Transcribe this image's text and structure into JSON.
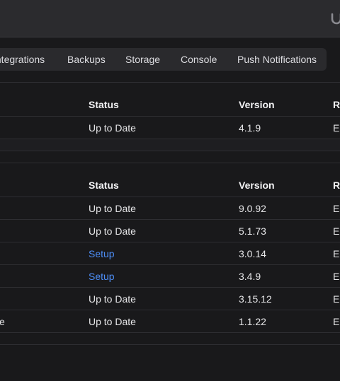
{
  "header": {
    "brand_logo_icon": "ubiquiti-u-icon"
  },
  "tabs": [
    {
      "label": "Integrations"
    },
    {
      "label": "Backups"
    },
    {
      "label": "Storage"
    },
    {
      "label": "Console"
    },
    {
      "label": "Push Notifications"
    }
  ],
  "table1": {
    "headers": {
      "status": "Status",
      "version": "Version",
      "release": "Re"
    },
    "rows": [
      {
        "name": "",
        "status": "Up to Date",
        "version": "4.1.9",
        "release": "Ea"
      }
    ]
  },
  "table2": {
    "headers": {
      "status": "Status",
      "version": "Version",
      "release": "Re"
    },
    "rows": [
      {
        "name": "",
        "status": "Up to Date",
        "version": "9.0.92",
        "release": "Ea"
      },
      {
        "name": "",
        "status": "Up to Date",
        "version": "5.1.73",
        "release": "Ea"
      },
      {
        "name": "",
        "status": "Setup",
        "version": "3.0.14",
        "release": "Ea"
      },
      {
        "name": "",
        "status": "Setup",
        "version": "3.4.9",
        "release": "Ea"
      },
      {
        "name": "",
        "status": "Up to Date",
        "version": "3.15.12",
        "release": "Ea"
      },
      {
        "name": "e",
        "status": "Up to Date",
        "version": "1.1.22",
        "release": "Ea"
      }
    ]
  },
  "colors": {
    "link": "#4d8ef7",
    "background": "#19191b",
    "topbar": "#2b2b2e"
  }
}
